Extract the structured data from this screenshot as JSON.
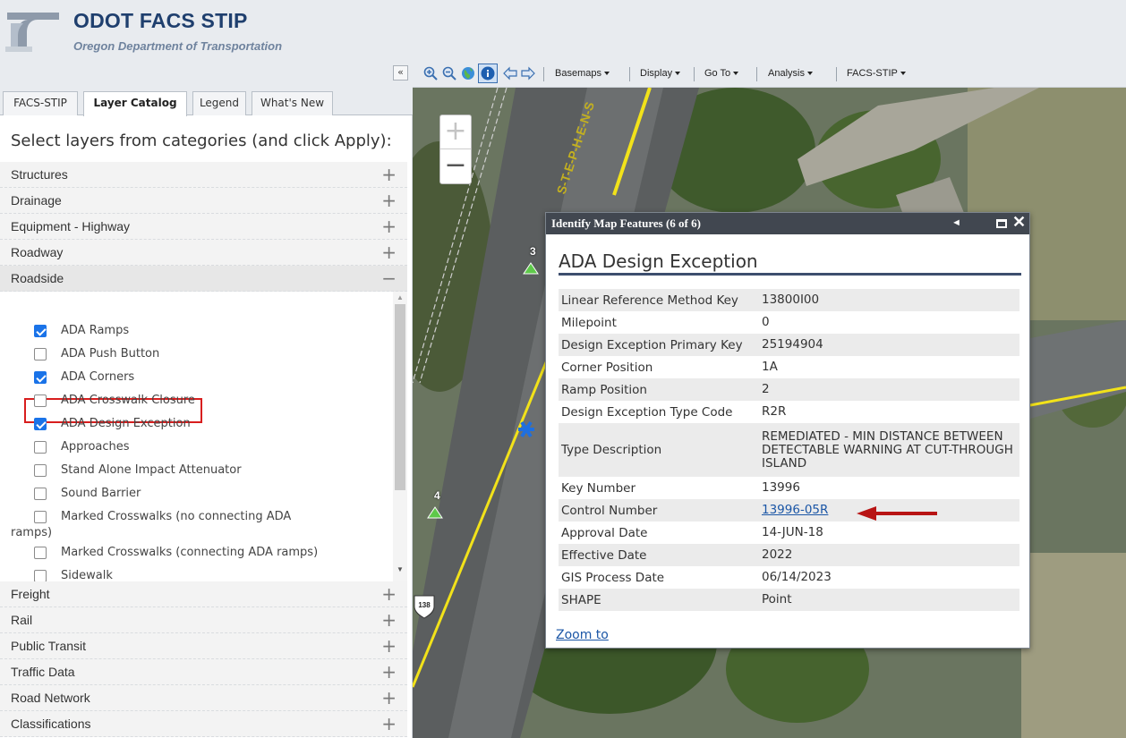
{
  "header": {
    "title": "ODOT FACS STIP",
    "subtitle": "Oregon Department of Transportation",
    "logo_icon": "odot-logo-icon"
  },
  "left_panel": {
    "collapse_icon": "double-chevron-left-icon",
    "collapse_label": "«",
    "tabs": [
      {
        "label": "FACS-STIP",
        "active": false
      },
      {
        "label": "Layer Catalog",
        "active": true
      },
      {
        "label": "Legend",
        "active": false
      },
      {
        "label": "What's New",
        "active": false
      }
    ],
    "heading": "Select layers from categories (and click Apply):",
    "categories_top": [
      {
        "label": "Structures",
        "toggle": "+"
      },
      {
        "label": "Drainage",
        "toggle": "+"
      },
      {
        "label": "Equipment - Highway",
        "toggle": "+"
      },
      {
        "label": "Roadway",
        "toggle": "+"
      },
      {
        "label": "Roadside",
        "toggle": "−"
      }
    ],
    "roadside_layers": [
      {
        "label": "ADA Ramps",
        "checked": true
      },
      {
        "label": "ADA Push Button",
        "checked": false
      },
      {
        "label": "ADA Corners",
        "checked": true
      },
      {
        "label": "ADA Crosswalk Closure",
        "checked": false
      },
      {
        "label": "ADA Design Exception",
        "checked": true
      },
      {
        "label": "Approaches",
        "checked": false
      },
      {
        "label": "Stand Alone Impact Attenuator",
        "checked": false
      },
      {
        "label": "Sound Barrier",
        "checked": false
      },
      {
        "label": "Marked Crosswalks (no connecting ADA",
        "label_cont": "ramps)",
        "checked": false
      },
      {
        "label": "Marked Crosswalks (connecting ADA ramps)",
        "checked": false
      },
      {
        "label": "Sidewalk",
        "checked": false
      }
    ],
    "categories_bottom": [
      {
        "label": "Freight",
        "toggle": "+"
      },
      {
        "label": "Rail",
        "toggle": "+"
      },
      {
        "label": "Public Transit",
        "toggle": "+"
      },
      {
        "label": "Traffic Data",
        "toggle": "+"
      },
      {
        "label": "Road Network",
        "toggle": "+"
      },
      {
        "label": "Classifications",
        "toggle": "+"
      }
    ]
  },
  "toolbar": {
    "icons": [
      "zoom-in-icon",
      "zoom-out-icon",
      "globe-icon",
      "info-icon",
      "back-arrow-icon",
      "forward-arrow-icon"
    ],
    "menus": [
      "Basemaps",
      "Display",
      "Go To",
      "Analysis",
      "FACS-STIP"
    ]
  },
  "map": {
    "zoom_in": "+",
    "zoom_out": "−",
    "markers": [
      {
        "label": "3"
      },
      {
        "label": "4"
      }
    ],
    "route_shield": "138",
    "road_label": "S-T-E-P-H-E-N-S"
  },
  "popup": {
    "title": "Identify Map Features (6 of 6)",
    "heading": "ADA Design Exception",
    "rows": [
      {
        "key": "Linear Reference Method Key",
        "value": "13800I00",
        "link": false
      },
      {
        "key": "Milepoint",
        "value": "0",
        "link": false
      },
      {
        "key": "Design Exception Primary Key",
        "value": "25194904",
        "link": false
      },
      {
        "key": "Corner Position",
        "value": "1A",
        "link": false
      },
      {
        "key": "Ramp Position",
        "value": "2",
        "link": false
      },
      {
        "key": "Design Exception Type Code",
        "value": "R2R",
        "link": false
      },
      {
        "key": "Type Description",
        "value": "REMEDIATED - MIN DISTANCE BETWEEN DETECTABLE WARNING AT CUT-THROUGH ISLAND",
        "link": false
      },
      {
        "key": "Key Number",
        "value": "13996",
        "link": false
      },
      {
        "key": "Control Number",
        "value": "13996-05R",
        "link": true
      },
      {
        "key": "Approval Date",
        "value": "14-JUN-18",
        "link": false
      },
      {
        "key": "Effective Date",
        "value": "2022",
        "link": false
      },
      {
        "key": "GIS Process Date",
        "value": "06/14/2023",
        "link": false
      },
      {
        "key": "SHAPE",
        "value": "Point",
        "link": false
      }
    ],
    "zoom_to": "Zoom to"
  },
  "colors": {
    "highlight_box": "#d81e1e",
    "arrow": "#b81414",
    "checkbox_checked": "#1a73e8",
    "popup_titlebar": "#414750",
    "link": "#1b56a6"
  }
}
